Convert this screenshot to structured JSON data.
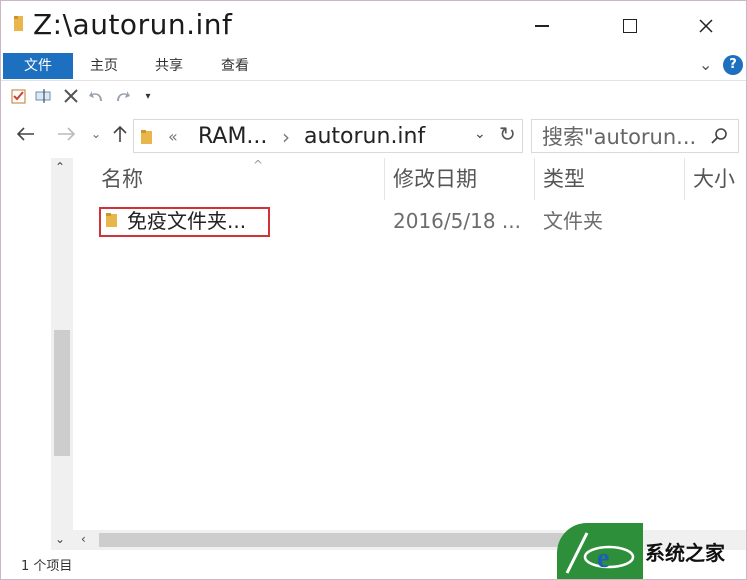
{
  "window": {
    "title": "Z:\\autorun.inf"
  },
  "ribbon": {
    "tabs": [
      "文件",
      "主页",
      "共享",
      "查看"
    ],
    "help": "?"
  },
  "address": {
    "overflow": "«",
    "crumbs": [
      "RAM...",
      "autorun.inf"
    ]
  },
  "search": {
    "placeholder": "搜索\"autorun..."
  },
  "columns": [
    "名称",
    "修改日期",
    "类型",
    "大小"
  ],
  "files": [
    {
      "name": "免疫文件夹...",
      "date": "2016/5/18 ...",
      "type": "文件夹"
    }
  ],
  "status": {
    "count": "1 个项目"
  },
  "watermark": {
    "text": "系统之家"
  },
  "colors": {
    "accent": "#1d6fbf",
    "highlight": "#d0343a",
    "folder": "#e8b64a"
  }
}
